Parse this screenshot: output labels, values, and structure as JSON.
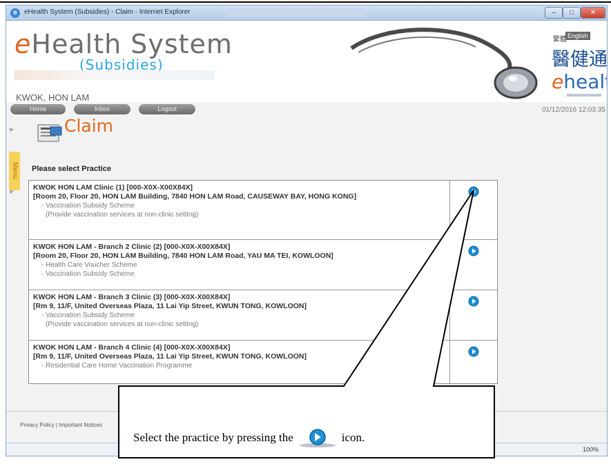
{
  "window": {
    "title": "eHealth System (Subsidies) - Claim - Internet Explorer",
    "min_label": "–",
    "max_label": "□",
    "close_label": "✕"
  },
  "header": {
    "logo_prefix": "e",
    "logo_main": "Health System",
    "logo_sub": "(Subsidies)",
    "username": "KWOK, HON LAM",
    "nav": {
      "home": "Home",
      "inbox": "Inbox",
      "logout": "Logout"
    },
    "lang_zh": "繁體",
    "lang_en": "English",
    "brand_zh": "醫健通",
    "brand_en_prefix": "e",
    "brand_en": "health",
    "datetime": "01/12/2016 12:03:35"
  },
  "sidebar": {
    "menu_label": "Menu"
  },
  "page": {
    "title": "Claim",
    "select_label": "Please select Practice"
  },
  "practices": [
    {
      "name": "KWOK HON LAM Clinic (1) [000-X0X-X00X84X]",
      "address": "[Room 20, Floor 20, HON LAM Building, 7840 HON LAM Road, CAUSEWAY BAY, HONG KONG]",
      "schemes": [
        "- Vaccination Subsidy Scheme"
      ],
      "note": "(Provide vaccination services at non-clinic setting)"
    },
    {
      "name": "KWOK HON LAM - Branch 2 Clinic (2) [000-X0X-X00X84X]",
      "address": "[Room 20, Floor 20, HON LAM Building, 7840 HON LAM Road, YAU MA TEI, KOWLOON]",
      "schemes": [
        "- Health Care Voucher Scheme",
        "- Vaccination Subsidy Scheme"
      ],
      "note": ""
    },
    {
      "name": "KWOK HON LAM - Branch 3 Clinic (3) [000-X0X-X00X84X]",
      "address": "[Rm 9, 11/F, United Overseas Plaza, 11 Lai Yip Street, KWUN TONG, KOWLOON]",
      "schemes": [
        "- Vaccination Subsidy Scheme"
      ],
      "note": "(Provide vaccination services at non-clinic setting)"
    },
    {
      "name": "KWOK HON LAM - Branch 4 Clinic (4) [000-X0X-X00X84X]",
      "address": "[Rm 9, 11/F, United Overseas Plaza, 11 Lai Yip Street, KWUN TONG, KOWLOON]",
      "schemes": [
        "- Residential Care Home Vaccination Programme"
      ],
      "note": ""
    }
  ],
  "footer": {
    "links": "Privacy Policy | Important Notices"
  },
  "statusbar": {
    "zoom": "100%"
  },
  "callout": {
    "text_before": "Select the practice by pressing the",
    "text_after": "icon."
  },
  "icons": {
    "select_icon": "play-circle-icon",
    "claim_icon": "claim-form-icon",
    "stethoscope": "stethoscope-image"
  },
  "colors": {
    "accent_orange": "#e06a1e",
    "logo_blue": "#2aa6e0",
    "brand_blue": "#1b4f8f",
    "menu_yellow": "#f7d25a"
  }
}
